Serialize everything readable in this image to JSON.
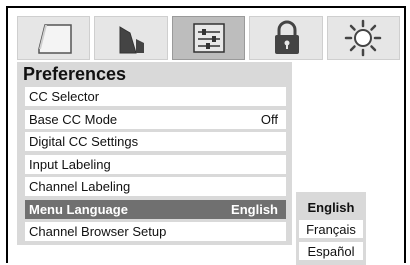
{
  "tabs": [
    {
      "icon": "picture-icon",
      "active": false
    },
    {
      "icon": "sound-icon",
      "active": false
    },
    {
      "icon": "settings-sliders-icon",
      "active": true
    },
    {
      "icon": "lock-icon",
      "active": false
    },
    {
      "icon": "sun-icon",
      "active": false
    }
  ],
  "panel": {
    "title": "Preferences",
    "items": [
      {
        "label": "CC Selector",
        "value": ""
      },
      {
        "label": "Base CC Mode",
        "value": "Off"
      },
      {
        "label": "Digital CC Settings",
        "value": ""
      },
      {
        "label": "Input Labeling",
        "value": ""
      },
      {
        "label": "Channel Labeling",
        "value": ""
      },
      {
        "label": "Menu Language",
        "value": "English",
        "selected": true
      },
      {
        "label": "Channel Browser Setup",
        "value": ""
      }
    ]
  },
  "language_options": [
    {
      "label": "English",
      "selected": true
    },
    {
      "label": "Français",
      "selected": false
    },
    {
      "label": "Español",
      "selected": false
    }
  ],
  "colors": {
    "selected_row": "#707070",
    "panel_bg": "#d9d9d9",
    "active_tab": "#bdbdbd"
  }
}
